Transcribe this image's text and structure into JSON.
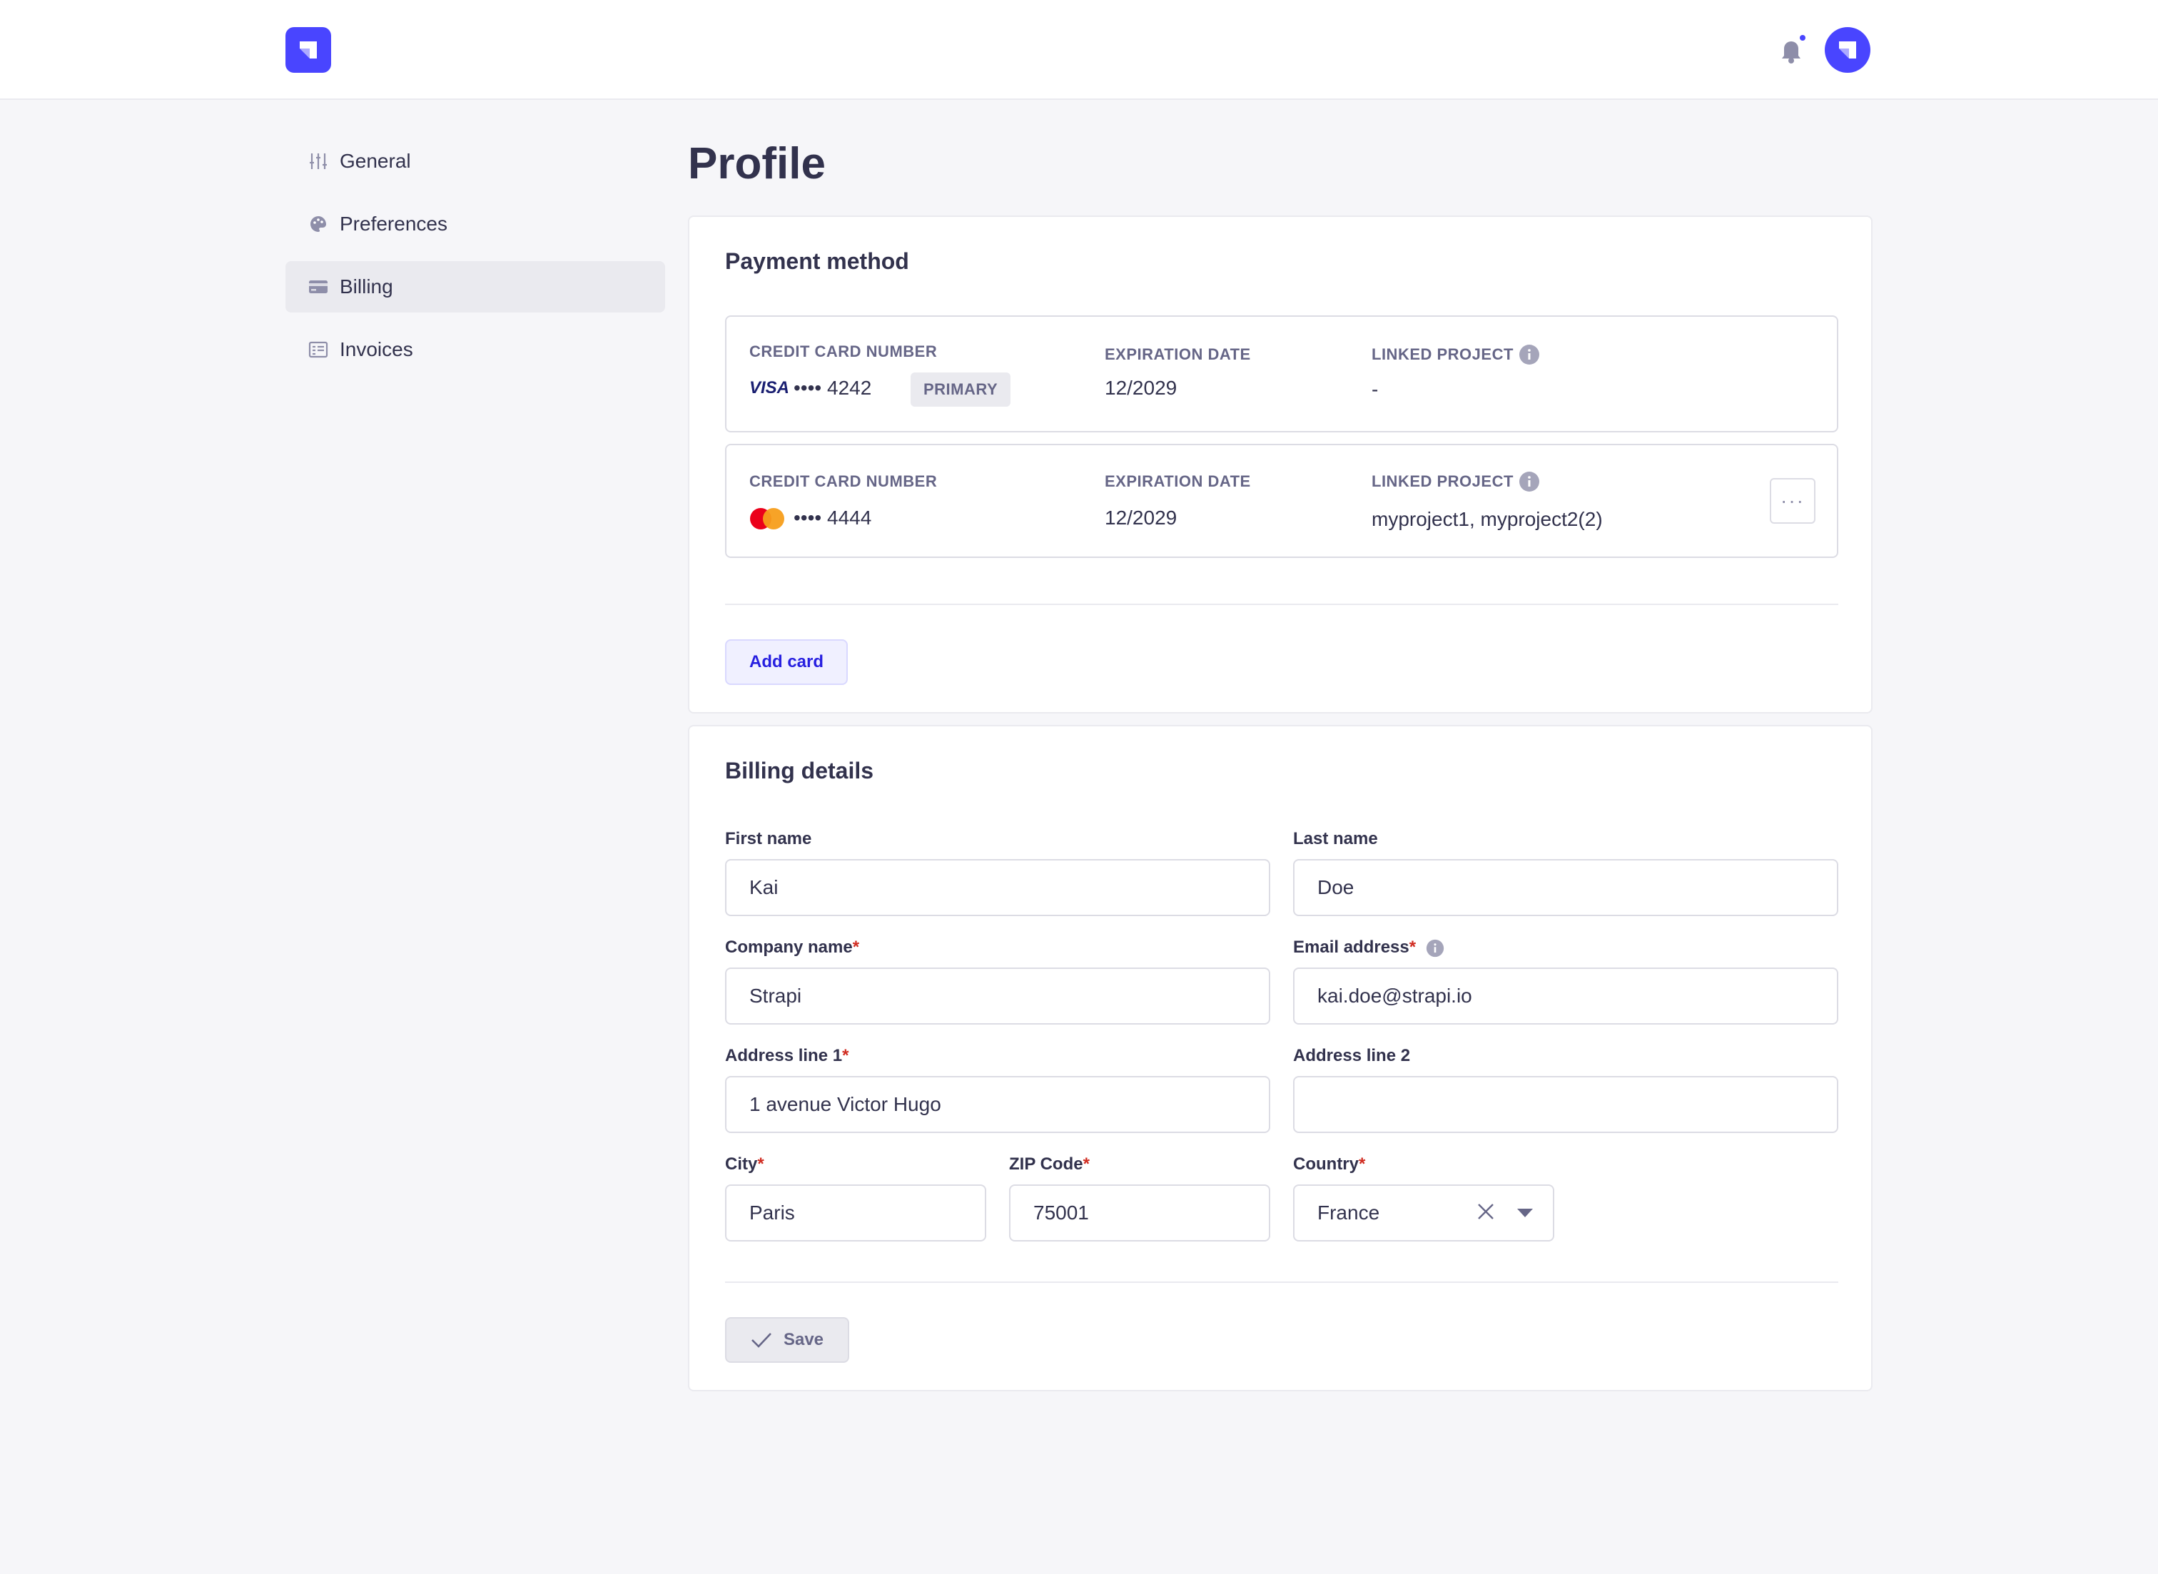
{
  "nav": {
    "items": [
      {
        "label": "General",
        "icon": "sliders-icon"
      },
      {
        "label": "Preferences",
        "icon": "palette-icon"
      },
      {
        "label": "Billing",
        "icon": "credit-card-icon"
      },
      {
        "label": "Invoices",
        "icon": "invoice-icon"
      }
    ],
    "active": "Billing"
  },
  "page": {
    "title": "Profile"
  },
  "payment": {
    "title": "Payment method",
    "cards": [
      {
        "number_label": "CREDIT CARD NUMBER",
        "brand": "VISA",
        "masked": "•••• 4242",
        "badge": "PRIMARY",
        "exp_label": "EXPIRATION DATE",
        "exp": "12/2029",
        "linked_label": "LINKED PROJECT",
        "linked": "-"
      },
      {
        "number_label": "CREDIT CARD NUMBER",
        "brand": "mastercard-icon",
        "masked": "•••• 4444",
        "exp_label": "EXPIRATION DATE",
        "exp": "12/2029",
        "linked_label": "LINKED PROJECT",
        "linked": "myproject1, myproject2(2)",
        "more": "···"
      }
    ],
    "add_label": "Add card"
  },
  "billing": {
    "title": "Billing details",
    "fields": {
      "first_name": {
        "label": "First name",
        "value": "Kai"
      },
      "last_name": {
        "label": "Last name",
        "value": "Doe"
      },
      "company": {
        "label": "Company name",
        "value": "Strapi"
      },
      "email": {
        "label": "Email address",
        "value": "kai.doe@strapi.io"
      },
      "address1": {
        "label": "Address line 1",
        "value": "1 avenue Victor Hugo"
      },
      "address2": {
        "label": "Address line 2",
        "value": ""
      },
      "city": {
        "label": "City",
        "value": "Paris"
      },
      "zip": {
        "label": "ZIP Code",
        "value": "75001"
      },
      "country": {
        "label": "Country",
        "value": "France"
      }
    },
    "required_mark": "*",
    "save_label": "Save"
  },
  "colors": {
    "accent": "#4945ff",
    "required": "#d02b20",
    "visa": "#1a1f71",
    "mastercard_red": "#eb001b",
    "mastercard_orange": "#f79e1b"
  }
}
